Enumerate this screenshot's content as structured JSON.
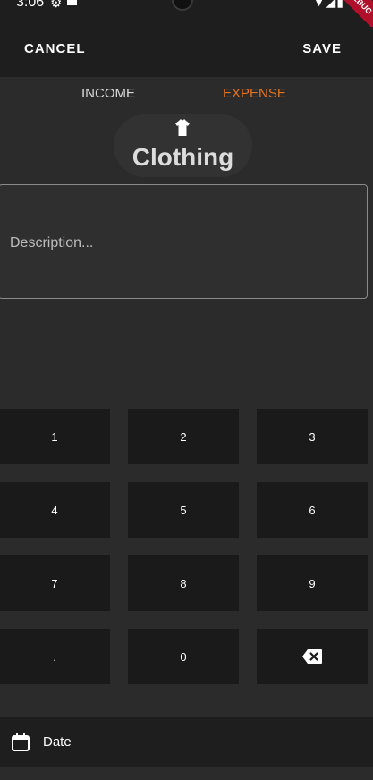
{
  "status_bar": {
    "time": "3:06",
    "gear_icon": "gear-icon",
    "debug_banner": "DEBUG"
  },
  "app_bar": {
    "cancel_label": "CANCEL",
    "save_label": "SAVE"
  },
  "tabs": {
    "income_label": "INCOME",
    "expense_label": "EXPENSE",
    "selected": "EXPENSE",
    "accent_color": "#e4731e"
  },
  "category": {
    "icon": "shirt-icon",
    "label": "Clothing"
  },
  "description": {
    "placeholder": "Description..."
  },
  "keypad": {
    "keys": [
      "1",
      "2",
      "3",
      "4",
      "5",
      "6",
      "7",
      "8",
      "9",
      ".",
      "0"
    ],
    "backspace_icon": "backspace-icon"
  },
  "date": {
    "icon": "calendar-icon",
    "label": "Date"
  }
}
